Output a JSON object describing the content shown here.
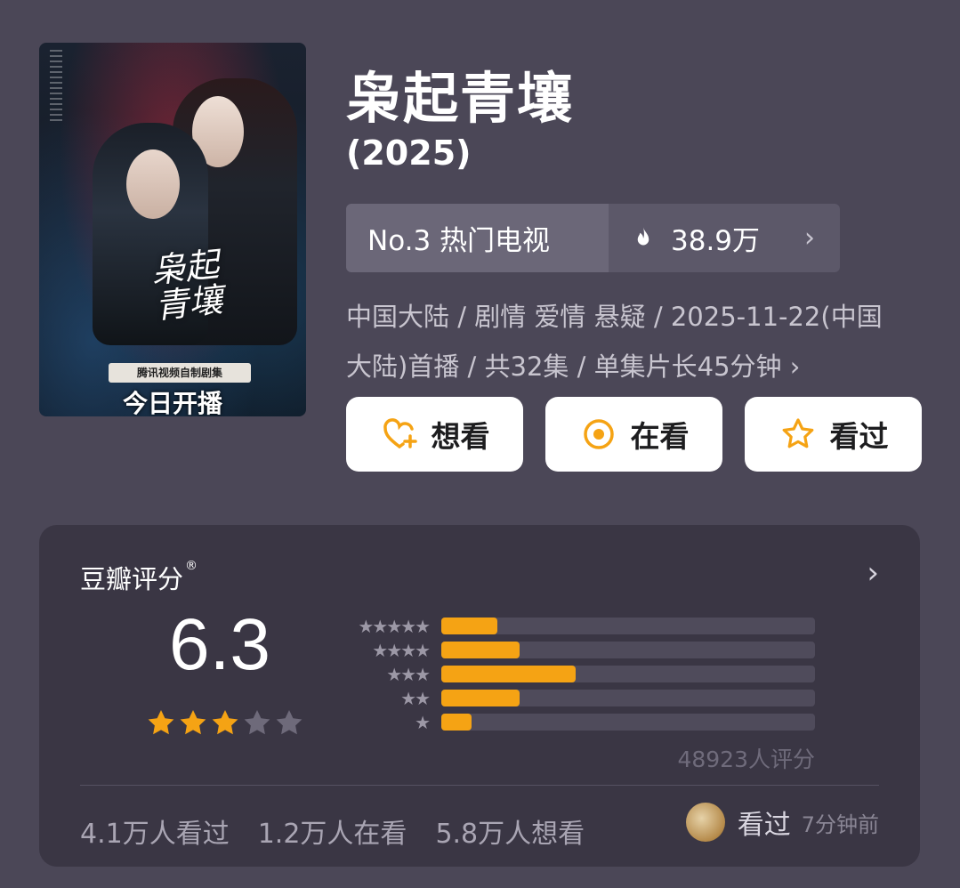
{
  "poster": {
    "calligraphy": "枭起青壤",
    "tag": "腾讯视频自制剧集",
    "premiere": "今日开播"
  },
  "title": "枭起青壤",
  "year": "(2025)",
  "rank": {
    "label": "No.3 热门电视",
    "heat": "38.9万"
  },
  "meta": "中国大陆 / 剧情 爱情 悬疑 / 2025-11-22(中国大陆)首播 / 共32集 / 单集片长45分钟",
  "actions": [
    {
      "label": "想看",
      "icon": "heart-plus-icon"
    },
    {
      "label": "在看",
      "icon": "target-icon"
    },
    {
      "label": "看过",
      "icon": "star-outline-icon"
    }
  ],
  "rating": {
    "title": "豆瓣评分",
    "registered_mark": "®",
    "score": "6.3",
    "stars_filled": 3,
    "stars_total": 5,
    "distribution": [
      {
        "stars": 5,
        "fraction": 0.15
      },
      {
        "stars": 4,
        "fraction": 0.21
      },
      {
        "stars": 3,
        "fraction": 0.36
      },
      {
        "stars": 2,
        "fraction": 0.21
      },
      {
        "stars": 1,
        "fraction": 0.08
      }
    ],
    "count": "48923人评分",
    "stats": [
      "4.1万人看过",
      "1.2万人在看",
      "5.8万人想看"
    ],
    "mine_status": "看过",
    "mine_time": "7分钟前"
  },
  "colors": {
    "background": "#4b4757",
    "card": "#3a3644",
    "accent": "#f5a314"
  }
}
